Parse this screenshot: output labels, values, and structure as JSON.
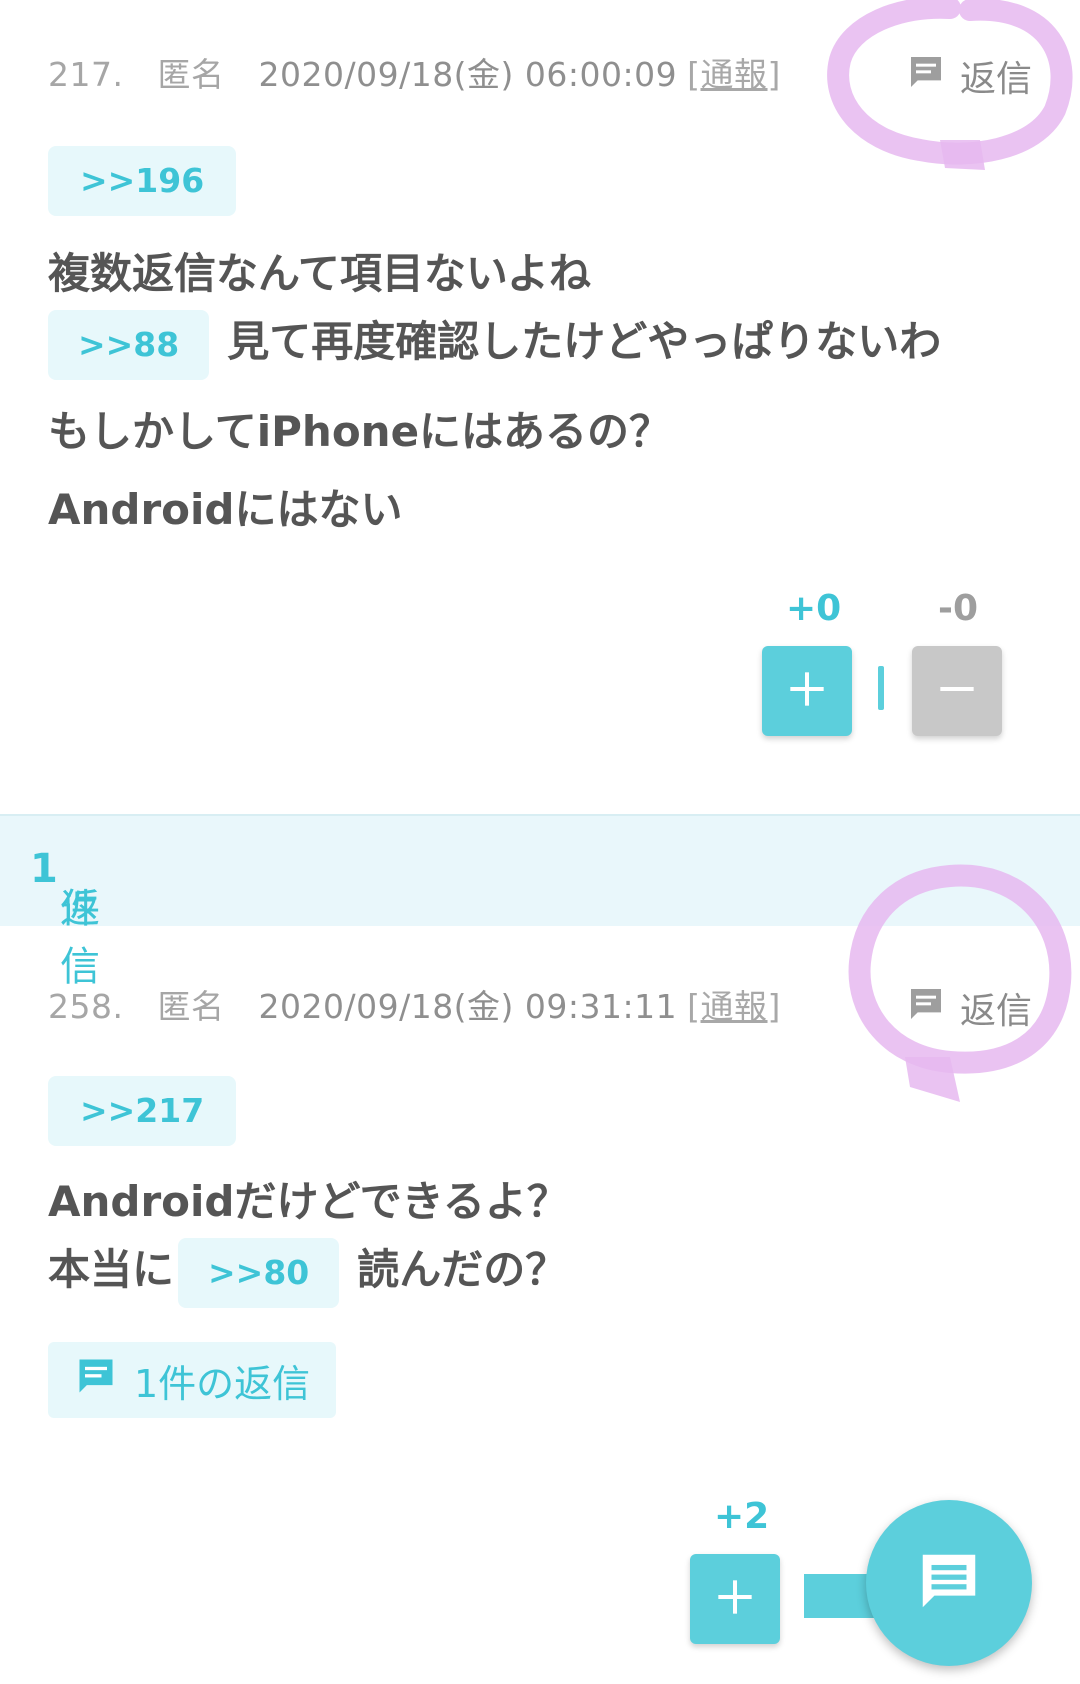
{
  "post1": {
    "number": "217.",
    "name": "匿名",
    "datetime": "2020/09/18(金) 06:00:09",
    "report_open": "[",
    "report_label": "通報",
    "report_close": "]",
    "reply_label": "返信",
    "anchor": ">>196",
    "line1": "複数返信なんて項目ないよね",
    "line2_anchor": ">>88",
    "line2_text": "見て再度確認したけどやっぱりないわ",
    "line3": "もしかしてiPhoneにはあるの？",
    "line4": "Androidにはない",
    "plus_count": "+0",
    "minus_count": "-0"
  },
  "replies_header": {
    "prefix": "返信",
    "count": "1",
    "suffix": "件"
  },
  "post2": {
    "number": "258.",
    "name": "匿名",
    "datetime": "2020/09/18(金) 09:31:11",
    "report_open": "[",
    "report_label": "通報",
    "report_close": "]",
    "reply_label": "返信",
    "anchor": ">>217",
    "line1": "Androidだけどできるよ？",
    "line2_prefix": "本当に",
    "line2_anchor": ">>80",
    "line2_text": "読んだの？",
    "reply_count_label": "1件の返信",
    "plus_count": "+2"
  },
  "colors": {
    "accent": "#5ccfdc",
    "accent_text": "#3ec4d6",
    "chip_bg": "#e7f8fb",
    "minus_button": "#c8c8c8",
    "scribble": "#e6b8f0"
  },
  "icons": {
    "reply": "comment-icon",
    "fab": "message-icon",
    "plus": "plus-icon",
    "minus": "minus-icon"
  }
}
